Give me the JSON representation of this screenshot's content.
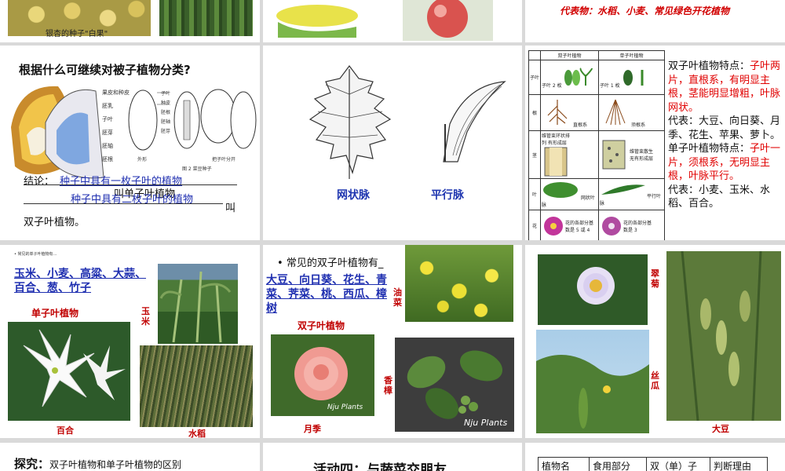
{
  "top_row": {
    "ginkgo_caption": "银杏的种子\"白果\"",
    "representatives": "代表物：水稻、小麦、常见绿色开花植物"
  },
  "classify": {
    "question": "根据什么可继续对被子植物分类?",
    "seed_labels": [
      "果皮和种皮",
      "胚乳",
      "子叶",
      "胚芽",
      "胚轴",
      "胚根"
    ],
    "bean_labels": [
      "子叶",
      "种皮",
      "胚根",
      "胚轴",
      "胚芽"
    ],
    "bean_caption1": "外形",
    "bean_caption2": "图 2  菜豆种子",
    "bean_caption3": "把子叶分开",
    "conclusion_label": "结论：",
    "conclusion_fill1": "种子中具有一枚子叶的植物",
    "conclusion_text1": "叫单子叶植物",
    "conclusion_fill2": "种子中具有二枚子叶的植物",
    "conclusion_text2": "叫",
    "conclusion_text3": "双子叶植物。"
  },
  "veins": {
    "net": "网状脉",
    "parallel": "平行脉"
  },
  "compare": {
    "col_dicot": "双子叶植物",
    "col_monocot": "单子叶植物",
    "rows": [
      "子叶",
      "根",
      "茎",
      "叶",
      "花"
    ],
    "cell_dicot_cotyledon": "子叶 2 枚",
    "cell_monocot_cotyledon": "子叶 1 枚",
    "cell_dicot_root": "直根系",
    "cell_monocot_root": "须根系",
    "cell_dicot_stem": "维管束环状排列 有形成层",
    "cell_monocot_stem": "维管束散生 无有形成层",
    "cell_dicot_leaf": "网状叶脉",
    "cell_monocot_leaf": "平行叶脉",
    "cell_dicot_flower": "花的各部分基数是 5 或 4",
    "cell_monocot_flower": "花的各部分基数是 3",
    "dicot_feature_label": "双子叶植物特点：",
    "dicot_feature": "子叶两片，直根系，有明显主根，茎能明显增粗，叶脉网状。",
    "dicot_rep": "代表：大豆、向日葵、月季、花生、苹果、萝卜。",
    "monocot_feature_label": "单子叶植物特点：",
    "monocot_feature": "子叶一片，须根系，无明显主根，叶脉平行。",
    "monocot_rep": "代表：小麦、玉米、水稻、百合。"
  },
  "monocots": {
    "small_header": "常见的单子叶植物有",
    "list": "玉米、小麦、高粱、大蒜、百合、葱、竹子",
    "title": "单子叶植物",
    "corn": "玉米",
    "lily": "百合",
    "rice": "水稻"
  },
  "dicots": {
    "bullet": "常见的双子叶植物有",
    "list": "大豆、向日葵、花生、青菜、荠菜、桃、西瓜、樟树",
    "title": "双子叶植物",
    "rapeseed": "油菜",
    "rose": "月季",
    "camphor": "香樟",
    "watermark": "Nju Plants"
  },
  "photos3": {
    "daisy": "翠菊",
    "loofah": "丝瓜",
    "soybean": "大豆"
  },
  "bottom_row": {
    "explore_label": "探究：",
    "explore_text": "双子叶植物和单子叶植物的区别",
    "activity": "活动四：与蔬菜交朋友",
    "table_headers": [
      "植物名",
      "食用部分",
      "双（单）子",
      "判断理由"
    ]
  }
}
